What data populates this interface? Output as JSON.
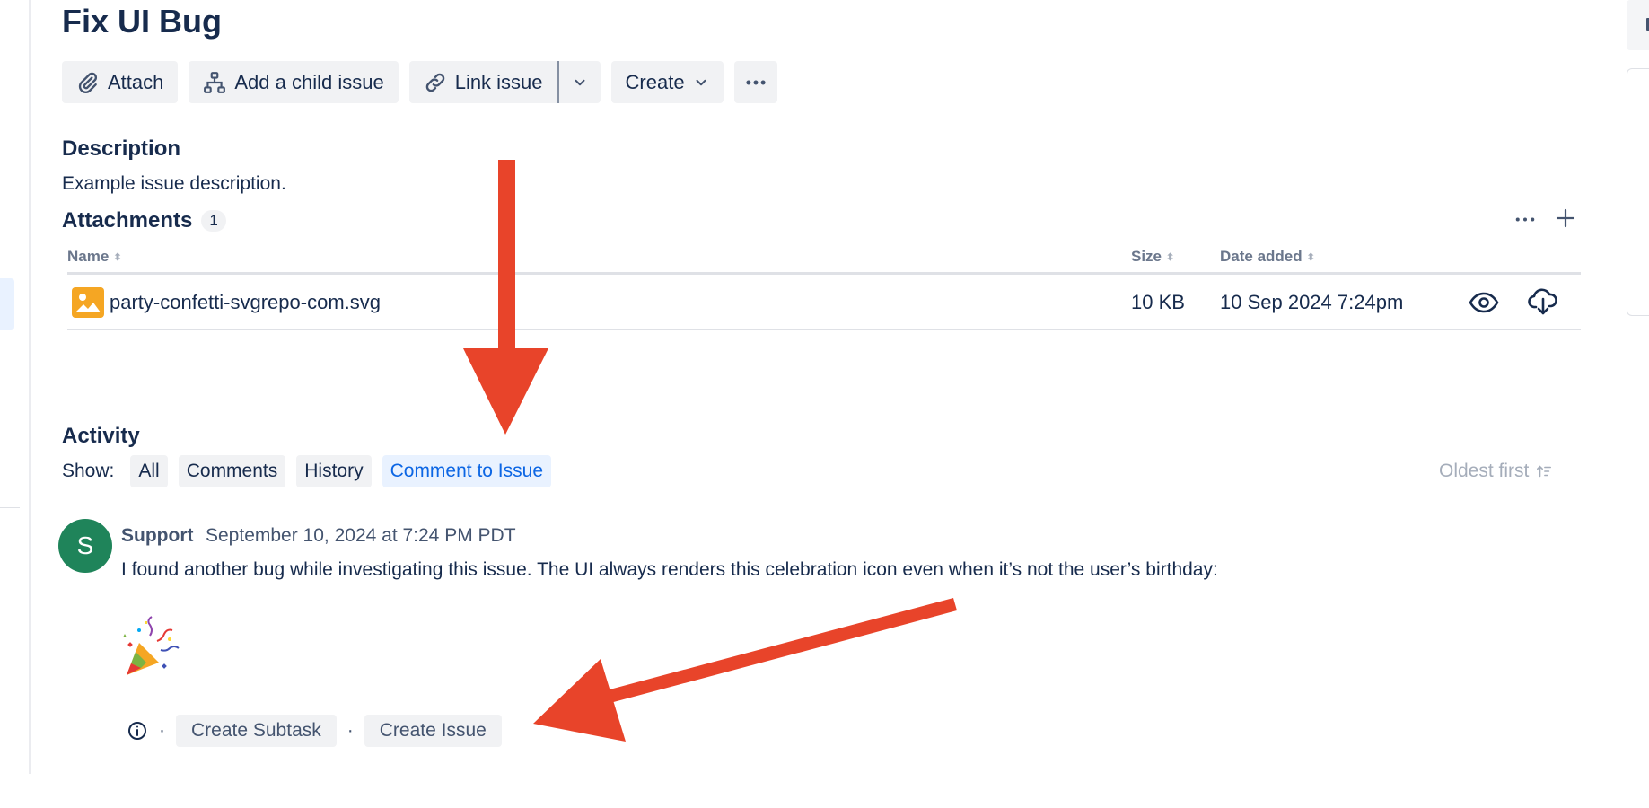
{
  "issue": {
    "title": "Fix UI Bug"
  },
  "toolbar": {
    "attach_label": "Attach",
    "child_issue_label": "Add a child issue",
    "link_issue_label": "Link issue",
    "create_label": "Create"
  },
  "description": {
    "heading": "Description",
    "text": "Example issue description."
  },
  "attachments": {
    "heading": "Attachments",
    "count": "1",
    "columns": {
      "name": "Name",
      "size": "Size",
      "date": "Date added"
    },
    "files": [
      {
        "name": "party-confetti-svgrepo-com.svg",
        "size": "10 KB",
        "date": "10 Sep 2024 7:24pm"
      }
    ]
  },
  "activity": {
    "heading": "Activity",
    "show_label": "Show:",
    "filters": [
      "All",
      "Comments",
      "History",
      "Comment to Issue"
    ],
    "active_filter": "Comment to Issue",
    "sort_label": "Oldest first",
    "comment": {
      "avatar_initial": "S",
      "author": "Support",
      "timestamp": "September 10, 2024 at 7:24 PM PDT",
      "text": "I found another bug while investigating this issue. The UI always renders this celebration icon even when it’s not the user’s birthday:",
      "actions": [
        "Create Subtask",
        "Create Issue"
      ],
      "separator": "·"
    }
  },
  "colors": {
    "accent": "#0c66e4",
    "avatar": "#1f845a",
    "annotation_arrow": "#e8442a",
    "file_icon": "#f5a623"
  }
}
